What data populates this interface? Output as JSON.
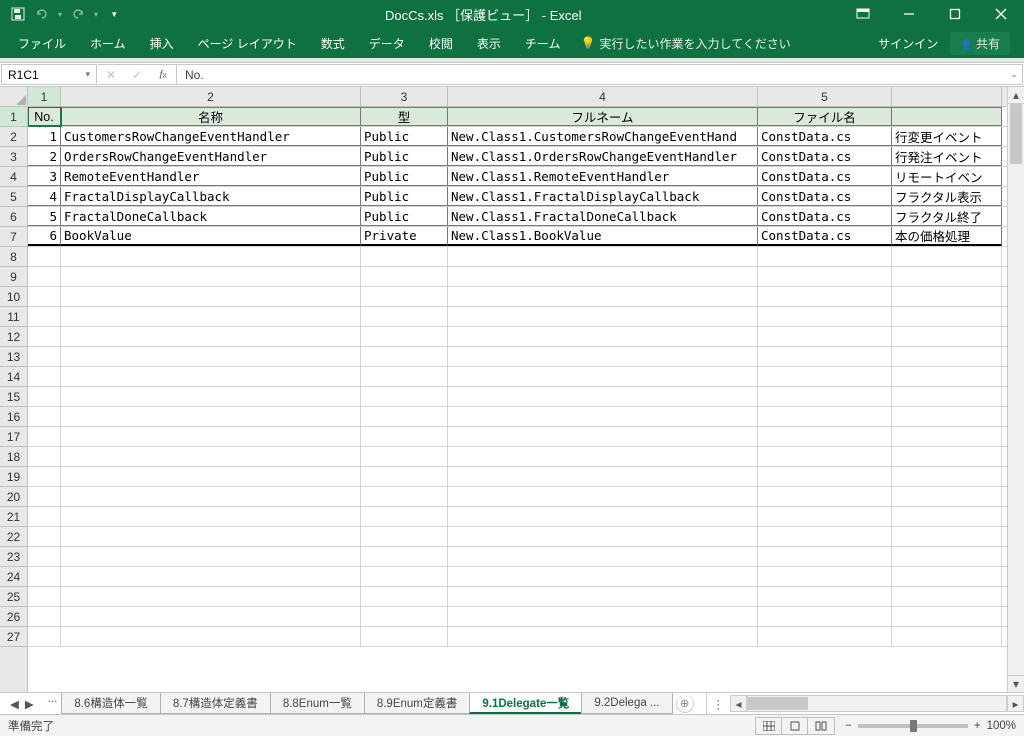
{
  "title": "DocCs.xls ［保護ビュー］ - Excel",
  "ribbon": {
    "tabs": [
      "ファイル",
      "ホーム",
      "挿入",
      "ページ レイアウト",
      "数式",
      "データ",
      "校閲",
      "表示",
      "チーム"
    ],
    "tellme": "実行したい作業を入力してください",
    "signin": "サインイン",
    "share": "共有"
  },
  "formula": {
    "namebox": "R1C1",
    "value": "No."
  },
  "columns": {
    "count": 5
  },
  "headers": [
    "No.",
    "名称",
    "型",
    "フルネーム",
    "ファイル名",
    ""
  ],
  "rows": [
    {
      "no": "1",
      "name": "CustomersRowChangeEventHandler",
      "type": "Public",
      "full": "New.Class1.CustomersRowChangeEventHand",
      "file": "ConstData.cs",
      "desc": "行変更イベント"
    },
    {
      "no": "2",
      "name": "OrdersRowChangeEventHandler",
      "type": "Public",
      "full": "New.Class1.OrdersRowChangeEventHandler",
      "file": "ConstData.cs",
      "desc": "行発注イベント"
    },
    {
      "no": "3",
      "name": "RemoteEventHandler",
      "type": "Public",
      "full": "New.Class1.RemoteEventHandler",
      "file": "ConstData.cs",
      "desc": "リモートイベン"
    },
    {
      "no": "4",
      "name": "FractalDisplayCallback",
      "type": "Public",
      "full": "New.Class1.FractalDisplayCallback",
      "file": "ConstData.cs",
      "desc": "フラクタル表示"
    },
    {
      "no": "5",
      "name": "FractalDoneCallback",
      "type": "Public",
      "full": "New.Class1.FractalDoneCallback",
      "file": "ConstData.cs",
      "desc": "フラクタル終了"
    },
    {
      "no": "6",
      "name": "BookValue",
      "type": "Private",
      "full": "New.Class1.BookValue",
      "file": "ConstData.cs",
      "desc": "本の価格処理"
    }
  ],
  "emptyRows": 20,
  "sheets": {
    "tabs": [
      "8.6構造体一覧",
      "8.7構造体定義書",
      "8.8Enum一覧",
      "8.9Enum定義書",
      "9.1Delegate一覧",
      "9.2Delega ..."
    ],
    "active": 4
  },
  "status": {
    "ready": "準備完了",
    "zoom": "100%"
  }
}
